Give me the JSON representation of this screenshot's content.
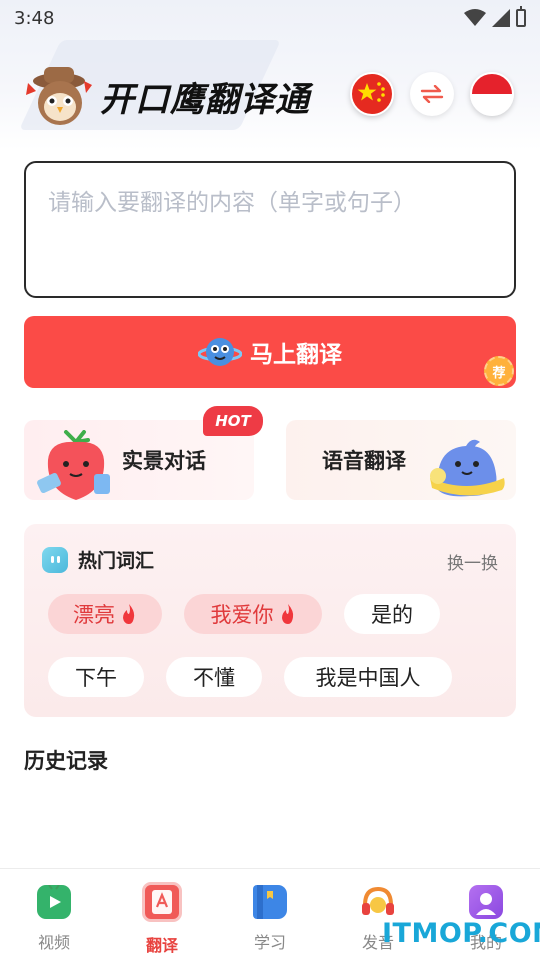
{
  "status_bar": {
    "time": "3:48"
  },
  "header": {
    "app_title": "开口鹰翻译通"
  },
  "input": {
    "placeholder": "请输入要翻译的内容（单字或句子）"
  },
  "translate_button": {
    "label": "马上翻译",
    "badge": "荐"
  },
  "features": {
    "scene": {
      "label": "实景对话",
      "badge": "HOT"
    },
    "voice": {
      "label": "语音翻译"
    }
  },
  "hot_words": {
    "title": "热门词汇",
    "refresh": "换一换",
    "chips": [
      {
        "text": "漂亮",
        "hot": true
      },
      {
        "text": "我爱你",
        "hot": true
      },
      {
        "text": "是的",
        "hot": false
      },
      {
        "text": "下午",
        "hot": false
      },
      {
        "text": "不懂",
        "hot": false
      },
      {
        "text": "我是中国人",
        "hot": false
      }
    ]
  },
  "history": {
    "title": "历史记录"
  },
  "tabs": [
    {
      "label": "视频",
      "icon": "video-icon",
      "active": false
    },
    {
      "label": "翻译",
      "icon": "translate-icon",
      "active": true
    },
    {
      "label": "学习",
      "icon": "book-icon",
      "active": false
    },
    {
      "label": "发音",
      "icon": "headphones-icon",
      "active": false
    },
    {
      "label": "我的",
      "icon": "profile-icon",
      "active": false
    }
  ],
  "watermark": "ITMOP.COM",
  "colors": {
    "accent": "#fb4b47",
    "hot_badge": "#ee3b45",
    "active_tab": "#e8433f"
  }
}
